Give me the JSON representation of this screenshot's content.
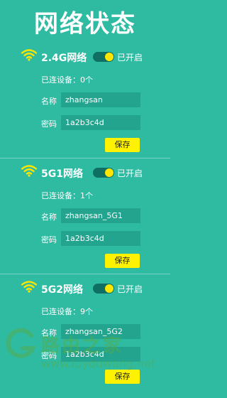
{
  "page": {
    "title": "网络状态"
  },
  "networks": [
    {
      "name": "2.4G网络",
      "toggle_label": "已开启",
      "enabled": true,
      "devices_text": "已连设备：0个",
      "name_label": "名称",
      "ssid": "zhangsan",
      "pass_label": "密码",
      "password": "1a2b3c4d",
      "save_label": "保存"
    },
    {
      "name": "5G1网络",
      "toggle_label": "已开启",
      "enabled": true,
      "devices_text": "已连设备：1个",
      "name_label": "名称",
      "ssid": "zhangsan_5G1",
      "pass_label": "密码",
      "password": "1a2b3c4d",
      "save_label": "保存"
    },
    {
      "name": "5G2网络",
      "toggle_label": "已开启",
      "enabled": true,
      "devices_text": "已连设备：9个",
      "name_label": "名称",
      "ssid": "zhangsan_5G2",
      "pass_label": "密码",
      "password": "1a2b3c4d",
      "save_label": "保存"
    }
  ],
  "watermark": {
    "text": "路由之家",
    "url": "www.luyouwang.net"
  },
  "icons": {
    "network": "wifi-icon"
  },
  "colors": {
    "background": "#2ebba2",
    "field": "#23a48e",
    "accent": "#fff200",
    "toggle_track": "#0e6f62",
    "icon": "#ffe600"
  }
}
